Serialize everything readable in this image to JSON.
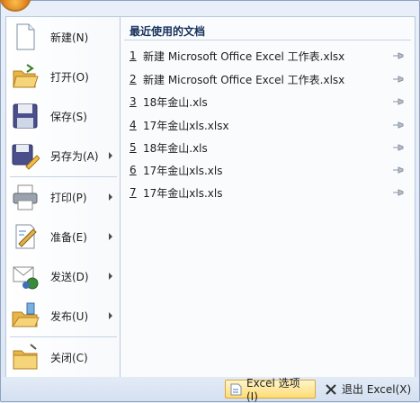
{
  "menu": {
    "items": [
      {
        "label": "新建(N)",
        "icon": "new-document-icon",
        "submenu": false
      },
      {
        "label": "打开(O)",
        "icon": "open-folder-icon",
        "submenu": false
      },
      {
        "label": "保存(S)",
        "icon": "save-floppy-icon",
        "submenu": false
      },
      {
        "label": "另存为(A)",
        "icon": "save-as-icon",
        "submenu": true
      },
      {
        "label": "打印(P)",
        "icon": "printer-icon",
        "submenu": true
      },
      {
        "label": "准备(E)",
        "icon": "prepare-icon",
        "submenu": true
      },
      {
        "label": "发送(D)",
        "icon": "send-icon",
        "submenu": true
      },
      {
        "label": "发布(U)",
        "icon": "publish-icon",
        "submenu": true
      },
      {
        "label": "关闭(C)",
        "icon": "close-folder-icon",
        "submenu": false
      }
    ]
  },
  "recent": {
    "title": "最近使用的文档",
    "items": [
      {
        "num": "1",
        "name": "新建 Microsoft Office Excel 工作表.xlsx"
      },
      {
        "num": "2",
        "name": "新建 Microsoft Office Excel 工作表.xlsx"
      },
      {
        "num": "3",
        "name": "18年金山.xls"
      },
      {
        "num": "4",
        "name": "17年金山xls.xlsx"
      },
      {
        "num": "5",
        "name": "18年金山.xls"
      },
      {
        "num": "6",
        "name": "17年金山xls.xls"
      },
      {
        "num": "7",
        "name": "17年金山xls.xls"
      }
    ]
  },
  "footer": {
    "options_label": "Excel 选项(I)",
    "exit_label": "退出 Excel(X)"
  }
}
